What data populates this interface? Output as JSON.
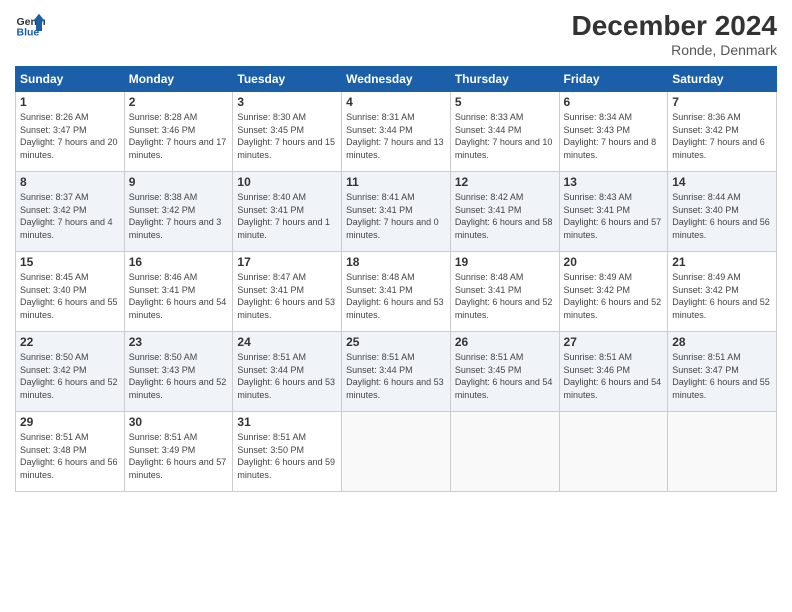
{
  "header": {
    "logo_line1": "General",
    "logo_line2": "Blue",
    "title": "December 2024",
    "subtitle": "Ronde, Denmark"
  },
  "days_of_week": [
    "Sunday",
    "Monday",
    "Tuesday",
    "Wednesday",
    "Thursday",
    "Friday",
    "Saturday"
  ],
  "weeks": [
    [
      {
        "day": "1",
        "sunrise": "Sunrise: 8:26 AM",
        "sunset": "Sunset: 3:47 PM",
        "daylight": "Daylight: 7 hours and 20 minutes."
      },
      {
        "day": "2",
        "sunrise": "Sunrise: 8:28 AM",
        "sunset": "Sunset: 3:46 PM",
        "daylight": "Daylight: 7 hours and 17 minutes."
      },
      {
        "day": "3",
        "sunrise": "Sunrise: 8:30 AM",
        "sunset": "Sunset: 3:45 PM",
        "daylight": "Daylight: 7 hours and 15 minutes."
      },
      {
        "day": "4",
        "sunrise": "Sunrise: 8:31 AM",
        "sunset": "Sunset: 3:44 PM",
        "daylight": "Daylight: 7 hours and 13 minutes."
      },
      {
        "day": "5",
        "sunrise": "Sunrise: 8:33 AM",
        "sunset": "Sunset: 3:44 PM",
        "daylight": "Daylight: 7 hours and 10 minutes."
      },
      {
        "day": "6",
        "sunrise": "Sunrise: 8:34 AM",
        "sunset": "Sunset: 3:43 PM",
        "daylight": "Daylight: 7 hours and 8 minutes."
      },
      {
        "day": "7",
        "sunrise": "Sunrise: 8:36 AM",
        "sunset": "Sunset: 3:42 PM",
        "daylight": "Daylight: 7 hours and 6 minutes."
      }
    ],
    [
      {
        "day": "8",
        "sunrise": "Sunrise: 8:37 AM",
        "sunset": "Sunset: 3:42 PM",
        "daylight": "Daylight: 7 hours and 4 minutes."
      },
      {
        "day": "9",
        "sunrise": "Sunrise: 8:38 AM",
        "sunset": "Sunset: 3:42 PM",
        "daylight": "Daylight: 7 hours and 3 minutes."
      },
      {
        "day": "10",
        "sunrise": "Sunrise: 8:40 AM",
        "sunset": "Sunset: 3:41 PM",
        "daylight": "Daylight: 7 hours and 1 minute."
      },
      {
        "day": "11",
        "sunrise": "Sunrise: 8:41 AM",
        "sunset": "Sunset: 3:41 PM",
        "daylight": "Daylight: 7 hours and 0 minutes."
      },
      {
        "day": "12",
        "sunrise": "Sunrise: 8:42 AM",
        "sunset": "Sunset: 3:41 PM",
        "daylight": "Daylight: 6 hours and 58 minutes."
      },
      {
        "day": "13",
        "sunrise": "Sunrise: 8:43 AM",
        "sunset": "Sunset: 3:41 PM",
        "daylight": "Daylight: 6 hours and 57 minutes."
      },
      {
        "day": "14",
        "sunrise": "Sunrise: 8:44 AM",
        "sunset": "Sunset: 3:40 PM",
        "daylight": "Daylight: 6 hours and 56 minutes."
      }
    ],
    [
      {
        "day": "15",
        "sunrise": "Sunrise: 8:45 AM",
        "sunset": "Sunset: 3:40 PM",
        "daylight": "Daylight: 6 hours and 55 minutes."
      },
      {
        "day": "16",
        "sunrise": "Sunrise: 8:46 AM",
        "sunset": "Sunset: 3:41 PM",
        "daylight": "Daylight: 6 hours and 54 minutes."
      },
      {
        "day": "17",
        "sunrise": "Sunrise: 8:47 AM",
        "sunset": "Sunset: 3:41 PM",
        "daylight": "Daylight: 6 hours and 53 minutes."
      },
      {
        "day": "18",
        "sunrise": "Sunrise: 8:48 AM",
        "sunset": "Sunset: 3:41 PM",
        "daylight": "Daylight: 6 hours and 53 minutes."
      },
      {
        "day": "19",
        "sunrise": "Sunrise: 8:48 AM",
        "sunset": "Sunset: 3:41 PM",
        "daylight": "Daylight: 6 hours and 52 minutes."
      },
      {
        "day": "20",
        "sunrise": "Sunrise: 8:49 AM",
        "sunset": "Sunset: 3:42 PM",
        "daylight": "Daylight: 6 hours and 52 minutes."
      },
      {
        "day": "21",
        "sunrise": "Sunrise: 8:49 AM",
        "sunset": "Sunset: 3:42 PM",
        "daylight": "Daylight: 6 hours and 52 minutes."
      }
    ],
    [
      {
        "day": "22",
        "sunrise": "Sunrise: 8:50 AM",
        "sunset": "Sunset: 3:42 PM",
        "daylight": "Daylight: 6 hours and 52 minutes."
      },
      {
        "day": "23",
        "sunrise": "Sunrise: 8:50 AM",
        "sunset": "Sunset: 3:43 PM",
        "daylight": "Daylight: 6 hours and 52 minutes."
      },
      {
        "day": "24",
        "sunrise": "Sunrise: 8:51 AM",
        "sunset": "Sunset: 3:44 PM",
        "daylight": "Daylight: 6 hours and 53 minutes."
      },
      {
        "day": "25",
        "sunrise": "Sunrise: 8:51 AM",
        "sunset": "Sunset: 3:44 PM",
        "daylight": "Daylight: 6 hours and 53 minutes."
      },
      {
        "day": "26",
        "sunrise": "Sunrise: 8:51 AM",
        "sunset": "Sunset: 3:45 PM",
        "daylight": "Daylight: 6 hours and 54 minutes."
      },
      {
        "day": "27",
        "sunrise": "Sunrise: 8:51 AM",
        "sunset": "Sunset: 3:46 PM",
        "daylight": "Daylight: 6 hours and 54 minutes."
      },
      {
        "day": "28",
        "sunrise": "Sunrise: 8:51 AM",
        "sunset": "Sunset: 3:47 PM",
        "daylight": "Daylight: 6 hours and 55 minutes."
      }
    ],
    [
      {
        "day": "29",
        "sunrise": "Sunrise: 8:51 AM",
        "sunset": "Sunset: 3:48 PM",
        "daylight": "Daylight: 6 hours and 56 minutes."
      },
      {
        "day": "30",
        "sunrise": "Sunrise: 8:51 AM",
        "sunset": "Sunset: 3:49 PM",
        "daylight": "Daylight: 6 hours and 57 minutes."
      },
      {
        "day": "31",
        "sunrise": "Sunrise: 8:51 AM",
        "sunset": "Sunset: 3:50 PM",
        "daylight": "Daylight: 6 hours and 59 minutes."
      },
      null,
      null,
      null,
      null
    ]
  ]
}
